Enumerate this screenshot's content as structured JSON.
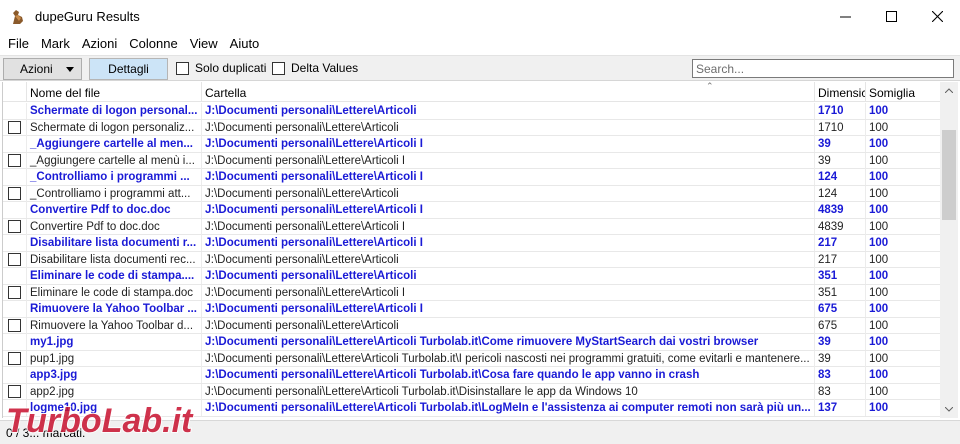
{
  "window": {
    "title": "dupeGuru Results",
    "icon": "dupeguru-icon"
  },
  "menu": [
    "File",
    "Mark",
    "Azioni",
    "Colonne",
    "View",
    "Aiuto"
  ],
  "toolbar": {
    "actions_label": "Azioni",
    "details_label": "Dettagli",
    "only_dupes_label": "Solo duplicati",
    "delta_values_label": "Delta Values",
    "search_placeholder": "Search..."
  },
  "columns": {
    "name": "Nome del file",
    "folder": "Cartella",
    "size": "Dimensic",
    "similarity": "Somiglia"
  },
  "rows": [
    {
      "type": "ref",
      "name": "Schermate di logon personal...",
      "folder": "J:\\Documenti personali\\Lettere\\Articoli",
      "size": "1710",
      "sim": "100"
    },
    {
      "type": "dup",
      "name": "Schermate di logon personaliz...",
      "folder": "J:\\Documenti personali\\Lettere\\Articoli",
      "size": "1710",
      "sim": "100"
    },
    {
      "type": "ref",
      "name": "_Aggiungere cartelle al men...",
      "folder": "J:\\Documenti personali\\Lettere\\Articoli I",
      "size": "39",
      "sim": "100"
    },
    {
      "type": "dup",
      "name": "_Aggiungere cartelle al menù i...",
      "folder": "J:\\Documenti personali\\Lettere\\Articoli I",
      "size": "39",
      "sim": "100"
    },
    {
      "type": "ref",
      "name": "_Controlliamo i programmi ...",
      "folder": "J:\\Documenti personali\\Lettere\\Articoli I",
      "size": "124",
      "sim": "100"
    },
    {
      "type": "dup",
      "name": "_Controlliamo i programmi att...",
      "folder": "J:\\Documenti personali\\Lettere\\Articoli",
      "size": "124",
      "sim": "100"
    },
    {
      "type": "ref",
      "name": "Convertire Pdf to doc.doc",
      "folder": "J:\\Documenti personali\\Lettere\\Articoli I",
      "size": "4839",
      "sim": "100"
    },
    {
      "type": "dup",
      "name": "Convertire Pdf to doc.doc",
      "folder": "J:\\Documenti personali\\Lettere\\Articoli I",
      "size": "4839",
      "sim": "100"
    },
    {
      "type": "ref",
      "name": "Disabilitare lista documenti r...",
      "folder": "J:\\Documenti personali\\Lettere\\Articoli I",
      "size": "217",
      "sim": "100"
    },
    {
      "type": "dup",
      "name": "Disabilitare lista documenti rec...",
      "folder": "J:\\Documenti personali\\Lettere\\Articoli",
      "size": "217",
      "sim": "100"
    },
    {
      "type": "ref",
      "name": "Eliminare le code di stampa....",
      "folder": "J:\\Documenti personali\\Lettere\\Articoli",
      "size": "351",
      "sim": "100"
    },
    {
      "type": "dup",
      "name": "Eliminare le code di stampa.doc",
      "folder": "J:\\Documenti personali\\Lettere\\Articoli I",
      "size": "351",
      "sim": "100"
    },
    {
      "type": "ref",
      "name": "Rimuovere la Yahoo Toolbar ...",
      "folder": "J:\\Documenti personali\\Lettere\\Articoli I",
      "size": "675",
      "sim": "100"
    },
    {
      "type": "dup",
      "name": "Rimuovere la Yahoo Toolbar d...",
      "folder": "J:\\Documenti personali\\Lettere\\Articoli",
      "size": "675",
      "sim": "100"
    },
    {
      "type": "ref",
      "name": "my1.jpg",
      "folder": "J:\\Documenti personali\\Lettere\\Articoli Turbolab.it\\Come rimuovere MyStartSearch dai vostri browser",
      "size": "39",
      "sim": "100"
    },
    {
      "type": "dup",
      "name": "pup1.jpg",
      "folder": "J:\\Documenti personali\\Lettere\\Articoli Turbolab.it\\I pericoli nascosti nei programmi gratuiti, come evitarli e mantenere...",
      "size": "39",
      "sim": "100"
    },
    {
      "type": "ref",
      "name": "app3.jpg",
      "folder": "J:\\Documenti personali\\Lettere\\Articoli Turbolab.it\\Cosa fare quando le app vanno in crash",
      "size": "83",
      "sim": "100"
    },
    {
      "type": "dup",
      "name": "app2.jpg",
      "folder": "J:\\Documenti personali\\Lettere\\Articoli Turbolab.it\\Disinstallare le app da Windows 10",
      "size": "83",
      "sim": "100"
    },
    {
      "type": "ref",
      "name": "logme10.jpg",
      "folder": "J:\\Documenti personali\\Lettere\\Articoli Turbolab.it\\LogMeIn e l'assistenza ai computer remoti non sarà più un...",
      "size": "137",
      "sim": "100"
    }
  ],
  "status": {
    "text": "0 / 3... marcati."
  },
  "watermark": {
    "text": "TurboLab.it"
  },
  "colors": {
    "reference_text": "#1a1ad6",
    "watermark": "#c8102e"
  }
}
